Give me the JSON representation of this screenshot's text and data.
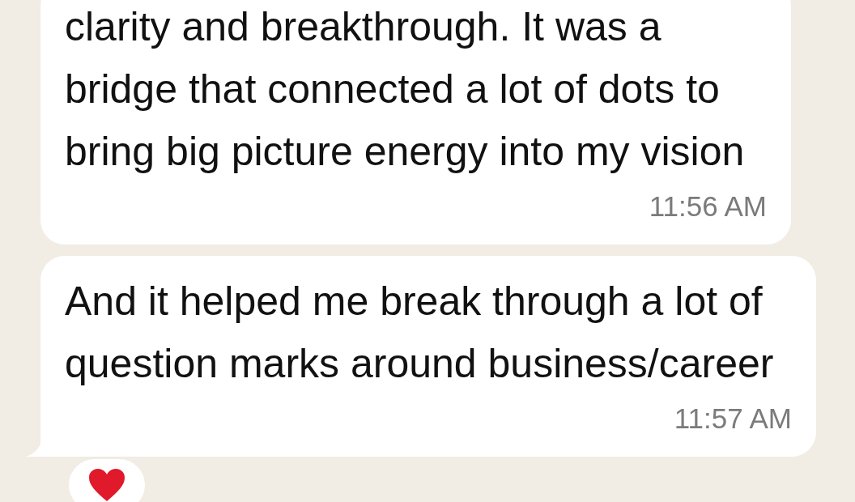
{
  "messages": [
    {
      "lines": [
        "clarity and breakthrough. It was a",
        "bridge that connected a lot of dots to",
        "bring big picture energy into my vision"
      ],
      "time": "11:56 AM",
      "tail": false
    },
    {
      "lines": [
        "And it helped me break through a lot of",
        "question marks around business/career"
      ],
      "time": "11:57 AM",
      "tail": true,
      "reaction": {
        "kind": "heart"
      }
    }
  ]
}
